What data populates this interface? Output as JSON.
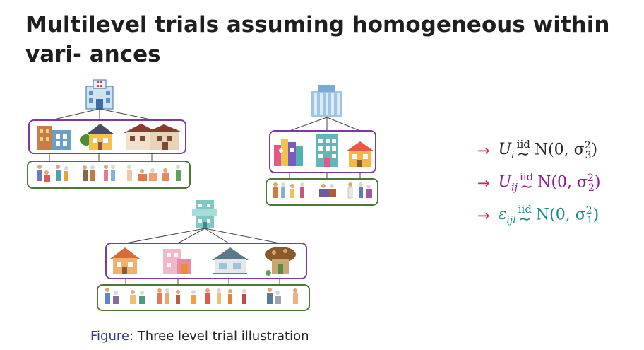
{
  "slide": {
    "title": "Multilevel trials assuming homogeneous within vari- ances"
  },
  "figure": {
    "caption_label": "Figure:",
    "caption_text": "Three level trial illustration"
  },
  "equations": [
    {
      "arrow": "→",
      "var": "U",
      "sub": "i",
      "iid": "iid",
      "dist": "N(0, σ",
      "sigma_sub": "3",
      "sup": "2",
      "close": ")",
      "color": "#2a2a2a"
    },
    {
      "arrow": "→",
      "var": "U",
      "sub": "ij",
      "iid": "iid",
      "dist": "N(0, σ",
      "sigma_sub": "2",
      "sup": "2",
      "close": ")",
      "color": "#8e1a8c"
    },
    {
      "arrow": "→",
      "var": "ε",
      "sub": "ijl",
      "iid": "iid",
      "dist": "N(0, σ",
      "sigma_sub": "1",
      "sup": "2",
      "close": ")",
      "color": "#1a8a8a"
    }
  ],
  "colors": {
    "level2_box": "#7a3b9c",
    "level1_box": "#4a7a36",
    "arrow": "#c62a55"
  }
}
